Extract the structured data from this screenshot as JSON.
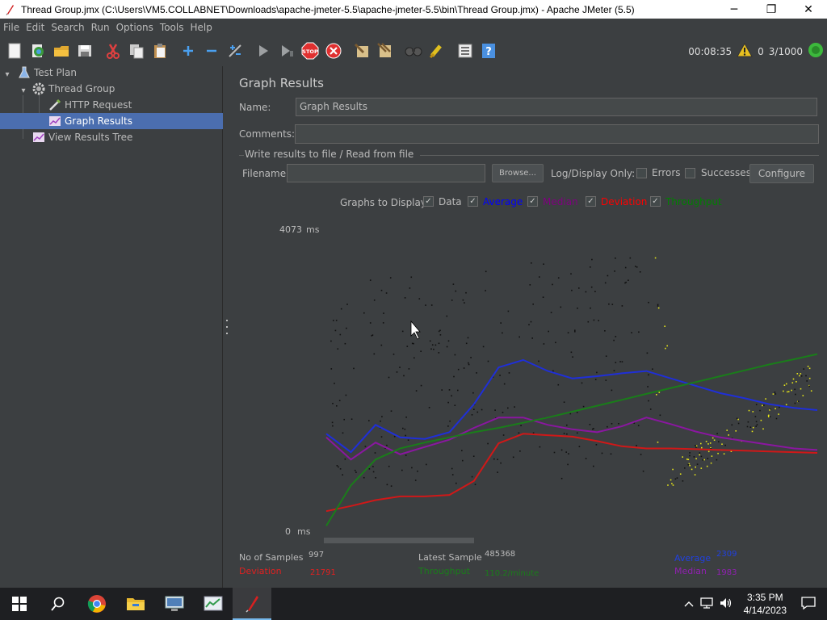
{
  "window": {
    "title": "Thread Group.jmx (C:\\Users\\VM5.COLLABNET\\Downloads\\apache-jmeter-5.5\\apache-jmeter-5.5\\bin\\Thread Group.jmx) - Apache JMeter (5.5)",
    "minimize_glyph": "─",
    "maximize_glyph": "❐",
    "close_glyph": "✕"
  },
  "menubar": {
    "items": [
      {
        "label": "File"
      },
      {
        "label": "Edit"
      },
      {
        "label": "Search"
      },
      {
        "label": "Run"
      },
      {
        "label": "Options"
      },
      {
        "label": "Tools"
      },
      {
        "label": "Help"
      }
    ]
  },
  "toolbar": {
    "buttons": [
      "new-icon",
      "templates-icon",
      "open-icon",
      "save-icon",
      "cut-icon",
      "copy-icon",
      "paste-icon",
      "expand-icon",
      "collapse-icon",
      "toggle-icon",
      "start-icon",
      "start-no-pause-icon",
      "stop-icon",
      "shutdown-icon",
      "clear-icon",
      "clear-all-icon",
      "search-icon",
      "reset-search-icon",
      "function-helper-icon",
      "help-icon"
    ],
    "elapsed": "00:08:35",
    "warnings": "0",
    "threads": "3/1000"
  },
  "tree": {
    "items": [
      {
        "label": "Test Plan",
        "icon": "test-plan-icon"
      },
      {
        "label": "Thread Group",
        "icon": "gear-icon"
      },
      {
        "label": "HTTP Request",
        "icon": "pipette-icon"
      },
      {
        "label": "Graph Results",
        "icon": "graph-icon",
        "selected": true
      },
      {
        "label": "View Results Tree",
        "icon": "graph-icon"
      }
    ]
  },
  "panel": {
    "heading": "Graph Results",
    "name_label": "Name:",
    "name_value": "Graph Results",
    "comments_label": "Comments:",
    "comments_value": "",
    "fieldset_title": "Write results to file / Read from file",
    "filename_label": "Filename",
    "filename_value": "",
    "browse_label": "Browse...",
    "log_display_label": "Log/Display Only:",
    "errors_label": "Errors",
    "successes_label": "Successes",
    "configure_label": "Configure",
    "graphs_to_display_label": "Graphs to Display",
    "graph_options": [
      {
        "label": "Data",
        "color": "#bbbbbb",
        "checked": true
      },
      {
        "label": "Average",
        "color": "#0000ff",
        "checked": true
      },
      {
        "label": "Median",
        "color": "#800080",
        "checked": true
      },
      {
        "label": "Deviation",
        "color": "#ff0000",
        "checked": true
      },
      {
        "label": "Throughput",
        "color": "#008000",
        "checked": true
      }
    ]
  },
  "chart_data": {
    "type": "line",
    "y_max_label": "4073",
    "y_min_label": "0",
    "y_unit": "ms",
    "ylim": [
      0,
      4073
    ],
    "x": [
      0,
      50,
      100,
      150,
      200,
      250,
      300,
      350,
      400,
      450,
      500,
      550,
      600,
      650,
      700,
      750,
      800,
      850,
      900,
      950,
      997
    ],
    "series": [
      {
        "name": "Average",
        "color": "#1f2fd8",
        "values": [
          1300,
          1050,
          1420,
          1250,
          1230,
          1320,
          1700,
          2200,
          2300,
          2150,
          2050,
          2080,
          2120,
          2150,
          2050,
          1950,
          1850,
          1780,
          1700,
          1650,
          1620
        ]
      },
      {
        "name": "Median",
        "color": "#8a17a0",
        "values": [
          1250,
          950,
          1180,
          1020,
          1120,
          1220,
          1380,
          1520,
          1520,
          1420,
          1360,
          1320,
          1400,
          1520,
          1430,
          1330,
          1250,
          1200,
          1150,
          1100,
          1080
        ]
      },
      {
        "name": "Deviation",
        "color": "#d01818",
        "values": [
          250,
          320,
          400,
          450,
          450,
          470,
          660,
          1170,
          1300,
          1280,
          1260,
          1200,
          1130,
          1100,
          1100,
          1090,
          1080,
          1070,
          1060,
          1050,
          1040
        ]
      },
      {
        "name": "Throughput",
        "color": "#1a7d1a",
        "values": [
          50,
          600,
          950,
          1100,
          1180,
          1250,
          1320,
          1380,
          1450,
          1520,
          1600,
          1680,
          1760,
          1840,
          1920,
          2000,
          2080,
          2160,
          2240,
          2310,
          2380
        ]
      }
    ]
  },
  "stats": {
    "samples_label": "No of Samples",
    "samples_value": "997",
    "latest_label": "Latest Sample",
    "latest_value": "485368",
    "average_label": "Average",
    "average_value": "2309",
    "deviation_label": "Deviation",
    "deviation_value": "21791",
    "throughput_label": "Throughput",
    "throughput_value": "110.2/minute",
    "median_label": "Median",
    "median_value": "1983"
  },
  "taskbar": {
    "apps": [
      "start-icon",
      "search-icon",
      "chrome-icon",
      "file-explorer-icon",
      "remote-desktop-icon",
      "task-manager-icon",
      "jmeter-icon"
    ],
    "time": "3:35 PM",
    "date": "4/14/2023"
  }
}
